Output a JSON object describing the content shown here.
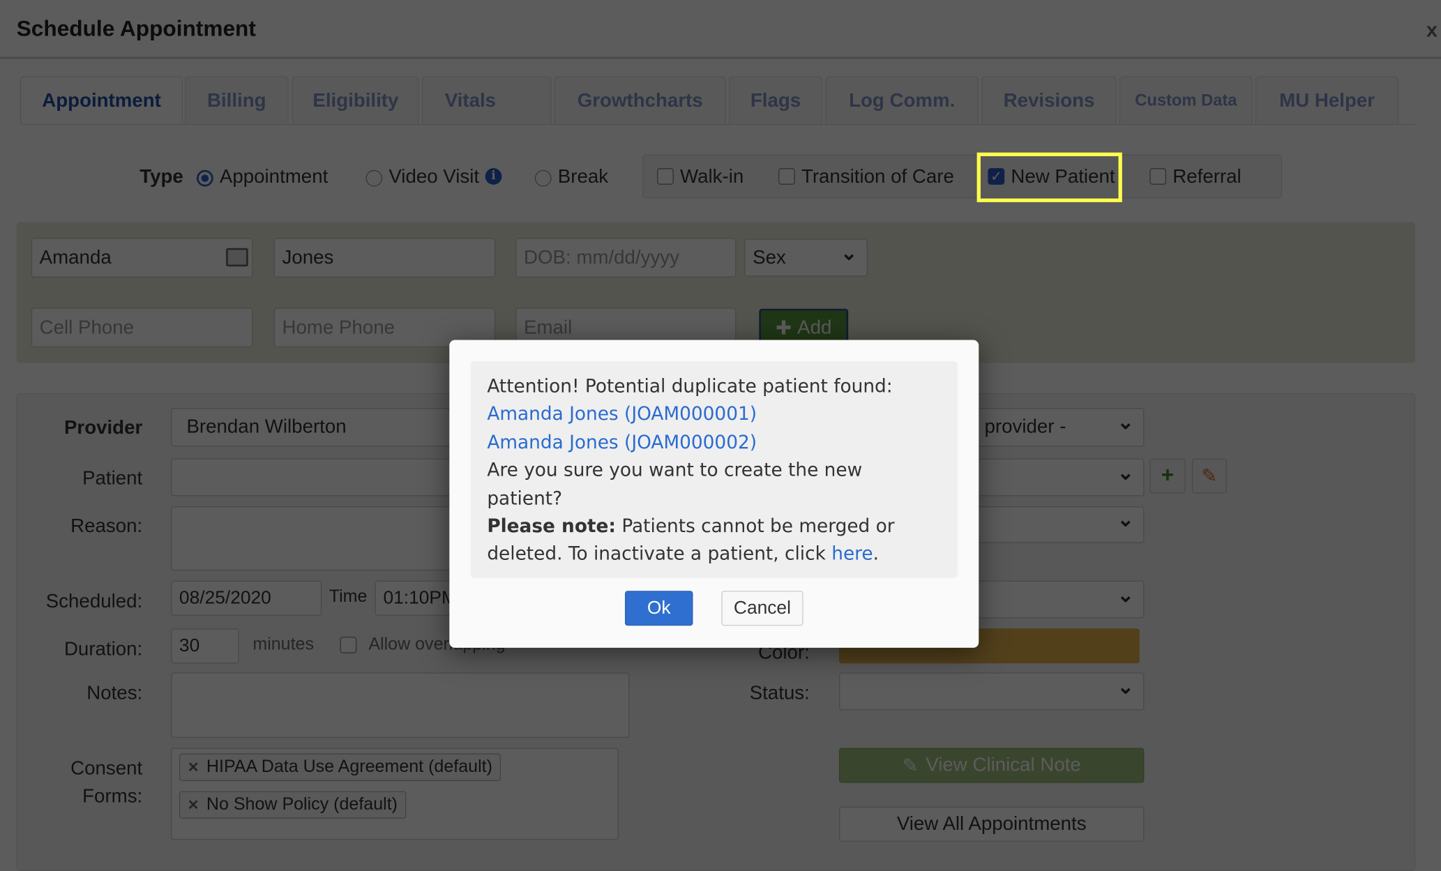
{
  "window": {
    "title": "Schedule Appointment",
    "close_label": "x"
  },
  "tabs": [
    {
      "label": "Appointment",
      "active": true
    },
    {
      "label": "Billing"
    },
    {
      "label": "Eligibility"
    },
    {
      "label": "Vitals"
    },
    {
      "label": "Growthcharts"
    },
    {
      "label": "Flags"
    },
    {
      "label": "Log Comm."
    },
    {
      "label": "Revisions"
    },
    {
      "label": "Custom Data"
    },
    {
      "label": "MU Helper"
    }
  ],
  "type": {
    "label": "Type",
    "options": [
      {
        "label": "Appointment",
        "selected": true
      },
      {
        "label": "Video Visit",
        "selected": false
      },
      {
        "label": "Break",
        "selected": false
      }
    ],
    "info_icon": "info-circle-icon"
  },
  "flags": [
    {
      "label": "Walk-in",
      "checked": false
    },
    {
      "label": "Transition of Care",
      "checked": false
    },
    {
      "label": "New Patient",
      "checked": true
    },
    {
      "label": "Referral",
      "checked": false
    }
  ],
  "highlight_color": "#ffff4d",
  "patient_form": {
    "first_name": "Amanda",
    "last_name": "Jones",
    "dob_placeholder": "DOB: mm/dd/yyyy",
    "sex_value": "Sex",
    "cell_placeholder": "Cell Phone",
    "home_placeholder": "Home Phone",
    "email_placeholder": "Email",
    "add_label": "Add"
  },
  "details": {
    "provider_label": "Provider",
    "provider_value": "Brendan Wilberton",
    "provider_select": "provider -",
    "patient_label": "Patient",
    "reason_label": "Reason:",
    "scheduled_label": "Scheduled:",
    "scheduled_value": "08/25/2020",
    "time_label": "Time",
    "time_value": "01:10PM",
    "duration_label": "Duration:",
    "duration_value": "30",
    "minutes_label": "minutes",
    "allow_overlap_label": "Allow overlapping",
    "color_label": "Color:",
    "color_value": "#e4b24a",
    "notes_label": "Notes:",
    "status_label": "Status:",
    "consent_label_1": "Consent",
    "consent_label_2": "Forms:",
    "consent_forms": [
      "HIPAA Data Use Agreement (default)",
      "No Show Policy (default)"
    ],
    "view_note_label": "View Clinical Note",
    "view_all_label": "View All Appointments"
  },
  "dialog": {
    "line1": "Attention! Potential duplicate patient found:",
    "links": [
      "Amanda Jones (JOAM000001)",
      "Amanda Jones (JOAM000002)"
    ],
    "question": "Are you sure you want to create the new patient?",
    "note_bold": "Please note:",
    "note_text": " Patients cannot be merged or deleted. To inactivate a patient, click ",
    "note_link": "here",
    "note_end": ".",
    "ok_label": "Ok",
    "cancel_label": "Cancel"
  }
}
